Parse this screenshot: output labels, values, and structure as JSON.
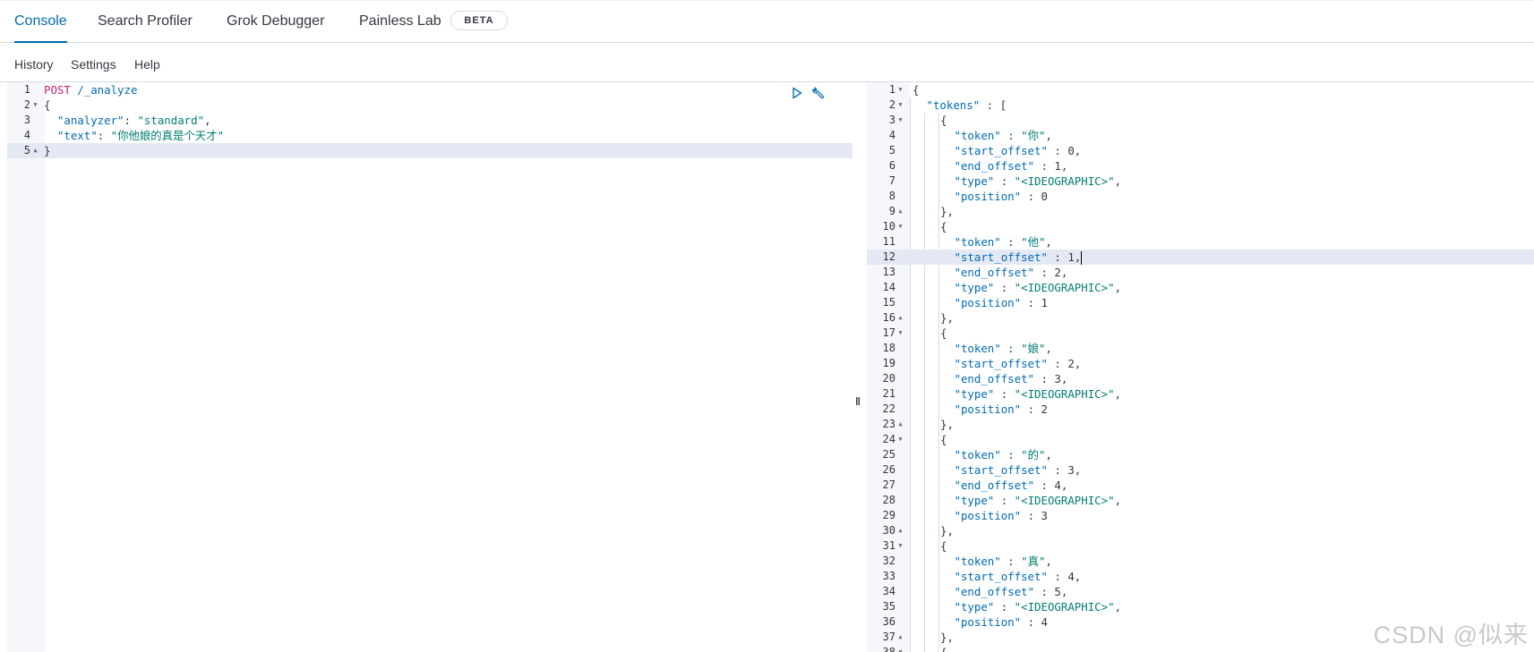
{
  "tabs": [
    {
      "label": "Console",
      "active": true
    },
    {
      "label": "Search Profiler"
    },
    {
      "label": "Grok Debugger"
    },
    {
      "label": "Painless Lab",
      "badge": "BETA"
    }
  ],
  "menu": {
    "history": "History",
    "settings": "Settings",
    "help": "Help"
  },
  "request": {
    "method": "POST",
    "path": " /_analyze",
    "lines": [
      {
        "n": "1",
        "fold": ""
      },
      {
        "n": "2",
        "fold": "▼",
        "text": "{"
      },
      {
        "n": "3",
        "fold": "",
        "key": "\"analyzer\"",
        "sep": ": ",
        "val": "\"standard\"",
        "tail": ","
      },
      {
        "n": "4",
        "fold": "",
        "key": "\"text\"",
        "sep": ": ",
        "val": "\"你他娘的真是个天才\"",
        "tail": ""
      },
      {
        "n": "5",
        "fold": "▲",
        "text": "}"
      }
    ]
  },
  "response": {
    "lines": [
      {
        "n": "1",
        "fold": "▼",
        "ind": 0,
        "text": "{"
      },
      {
        "n": "2",
        "fold": "▼",
        "ind": 1,
        "key": "\"tokens\"",
        "sep": " : ",
        "val": "[",
        "vt": "n"
      },
      {
        "n": "3",
        "fold": "▼",
        "ind": 2,
        "text": "{"
      },
      {
        "n": "4",
        "fold": "",
        "ind": 3,
        "key": "\"token\"",
        "sep": " : ",
        "val": "\"你\"",
        "vt": "s",
        "tail": ","
      },
      {
        "n": "5",
        "fold": "",
        "ind": 3,
        "key": "\"start_offset\"",
        "sep": " : ",
        "val": "0",
        "vt": "n",
        "tail": ","
      },
      {
        "n": "6",
        "fold": "",
        "ind": 3,
        "key": "\"end_offset\"",
        "sep": " : ",
        "val": "1",
        "vt": "n",
        "tail": ","
      },
      {
        "n": "7",
        "fold": "",
        "ind": 3,
        "key": "\"type\"",
        "sep": " : ",
        "val": "\"<IDEOGRAPHIC>\"",
        "vt": "s",
        "tail": ","
      },
      {
        "n": "8",
        "fold": "",
        "ind": 3,
        "key": "\"position\"",
        "sep": " : ",
        "val": "0",
        "vt": "n"
      },
      {
        "n": "9",
        "fold": "▲",
        "ind": 2,
        "text": "},"
      },
      {
        "n": "10",
        "fold": "▼",
        "ind": 2,
        "text": "{"
      },
      {
        "n": "11",
        "fold": "",
        "ind": 3,
        "key": "\"token\"",
        "sep": " : ",
        "val": "\"他\"",
        "vt": "s",
        "tail": ","
      },
      {
        "n": "12",
        "fold": "",
        "ind": 3,
        "key": "\"start_offset\"",
        "sep": " : ",
        "val": "1",
        "vt": "n",
        "tail": ",",
        "active": true,
        "cursor": true
      },
      {
        "n": "13",
        "fold": "",
        "ind": 3,
        "key": "\"end_offset\"",
        "sep": " : ",
        "val": "2",
        "vt": "n",
        "tail": ","
      },
      {
        "n": "14",
        "fold": "",
        "ind": 3,
        "key": "\"type\"",
        "sep": " : ",
        "val": "\"<IDEOGRAPHIC>\"",
        "vt": "s",
        "tail": ","
      },
      {
        "n": "15",
        "fold": "",
        "ind": 3,
        "key": "\"position\"",
        "sep": " : ",
        "val": "1",
        "vt": "n"
      },
      {
        "n": "16",
        "fold": "▲",
        "ind": 2,
        "text": "},"
      },
      {
        "n": "17",
        "fold": "▼",
        "ind": 2,
        "text": "{"
      },
      {
        "n": "18",
        "fold": "",
        "ind": 3,
        "key": "\"token\"",
        "sep": " : ",
        "val": "\"娘\"",
        "vt": "s",
        "tail": ","
      },
      {
        "n": "19",
        "fold": "",
        "ind": 3,
        "key": "\"start_offset\"",
        "sep": " : ",
        "val": "2",
        "vt": "n",
        "tail": ","
      },
      {
        "n": "20",
        "fold": "",
        "ind": 3,
        "key": "\"end_offset\"",
        "sep": " : ",
        "val": "3",
        "vt": "n",
        "tail": ","
      },
      {
        "n": "21",
        "fold": "",
        "ind": 3,
        "key": "\"type\"",
        "sep": " : ",
        "val": "\"<IDEOGRAPHIC>\"",
        "vt": "s",
        "tail": ","
      },
      {
        "n": "22",
        "fold": "",
        "ind": 3,
        "key": "\"position\"",
        "sep": " : ",
        "val": "2",
        "vt": "n"
      },
      {
        "n": "23",
        "fold": "▲",
        "ind": 2,
        "text": "},"
      },
      {
        "n": "24",
        "fold": "▼",
        "ind": 2,
        "text": "{"
      },
      {
        "n": "25",
        "fold": "",
        "ind": 3,
        "key": "\"token\"",
        "sep": " : ",
        "val": "\"的\"",
        "vt": "s",
        "tail": ","
      },
      {
        "n": "26",
        "fold": "",
        "ind": 3,
        "key": "\"start_offset\"",
        "sep": " : ",
        "val": "3",
        "vt": "n",
        "tail": ","
      },
      {
        "n": "27",
        "fold": "",
        "ind": 3,
        "key": "\"end_offset\"",
        "sep": " : ",
        "val": "4",
        "vt": "n",
        "tail": ","
      },
      {
        "n": "28",
        "fold": "",
        "ind": 3,
        "key": "\"type\"",
        "sep": " : ",
        "val": "\"<IDEOGRAPHIC>\"",
        "vt": "s",
        "tail": ","
      },
      {
        "n": "29",
        "fold": "",
        "ind": 3,
        "key": "\"position\"",
        "sep": " : ",
        "val": "3",
        "vt": "n"
      },
      {
        "n": "30",
        "fold": "▲",
        "ind": 2,
        "text": "},"
      },
      {
        "n": "31",
        "fold": "▼",
        "ind": 2,
        "text": "{"
      },
      {
        "n": "32",
        "fold": "",
        "ind": 3,
        "key": "\"token\"",
        "sep": " : ",
        "val": "\"真\"",
        "vt": "s",
        "tail": ","
      },
      {
        "n": "33",
        "fold": "",
        "ind": 3,
        "key": "\"start_offset\"",
        "sep": " : ",
        "val": "4",
        "vt": "n",
        "tail": ","
      },
      {
        "n": "34",
        "fold": "",
        "ind": 3,
        "key": "\"end_offset\"",
        "sep": " : ",
        "val": "5",
        "vt": "n",
        "tail": ","
      },
      {
        "n": "35",
        "fold": "",
        "ind": 3,
        "key": "\"type\"",
        "sep": " : ",
        "val": "\"<IDEOGRAPHIC>\"",
        "vt": "s",
        "tail": ","
      },
      {
        "n": "36",
        "fold": "",
        "ind": 3,
        "key": "\"position\"",
        "sep": " : ",
        "val": "4",
        "vt": "n"
      },
      {
        "n": "37",
        "fold": "▲",
        "ind": 2,
        "text": "},"
      },
      {
        "n": "38",
        "fold": "▼",
        "ind": 2,
        "text": "{"
      }
    ]
  },
  "divider_glyph": "‖",
  "watermark": "CSDN @似来"
}
